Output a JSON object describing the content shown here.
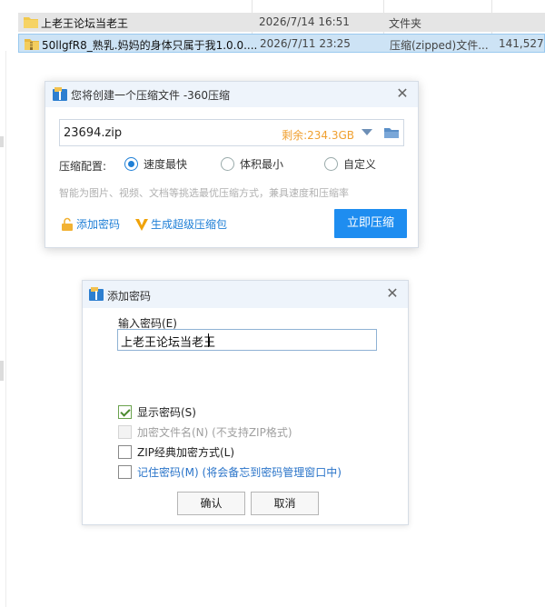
{
  "explorer": {
    "files": [
      {
        "name": "上老王论坛当老王",
        "date": "2026/7/14 16:51",
        "type": "文件夹",
        "size": ""
      },
      {
        "name": "50llgfR8_熟乳.妈妈的身体只属于我1.0.0....",
        "date": "2026/7/11 23:25",
        "type": "压缩(zipped)文件...",
        "size": "141,527"
      }
    ]
  },
  "compress_dialog": {
    "title": "您将创建一个压缩文件 -360压缩",
    "close_label": "✕",
    "filename": "23694.zip",
    "free_space": "剩余:234.3GB",
    "config_label": "压缩配置:",
    "options": [
      {
        "label": "速度最快",
        "selected": true
      },
      {
        "label": "体积最小",
        "selected": false
      },
      {
        "label": "自定义",
        "selected": false
      }
    ],
    "hint": "智能为图片、视频、文档等挑选最优压缩方式，兼具速度和压缩率",
    "add_password_label": "添加密码",
    "super_package_label": "生成超级压缩包",
    "compress_button": "立即压缩",
    "accent_color": "#1e8df0"
  },
  "password_dialog": {
    "title": "添加密码",
    "close_label": "✕",
    "input_label": "输入密码(E)",
    "password_value": "上老王论坛当老王",
    "checkboxes": [
      {
        "label": "显示密码(S)",
        "checked": true,
        "disabled": false,
        "style": "normal"
      },
      {
        "label": "加密文件名(N) (不支持ZIP格式)",
        "checked": false,
        "disabled": true,
        "style": "disabled"
      },
      {
        "label": "ZIP经典加密方式(L)",
        "checked": false,
        "disabled": false,
        "style": "normal"
      },
      {
        "label": "记住密码(M) (将会备忘到密码管理窗口中)",
        "checked": false,
        "disabled": false,
        "style": "blue"
      }
    ],
    "ok_button": "确认",
    "cancel_button": "取消"
  }
}
